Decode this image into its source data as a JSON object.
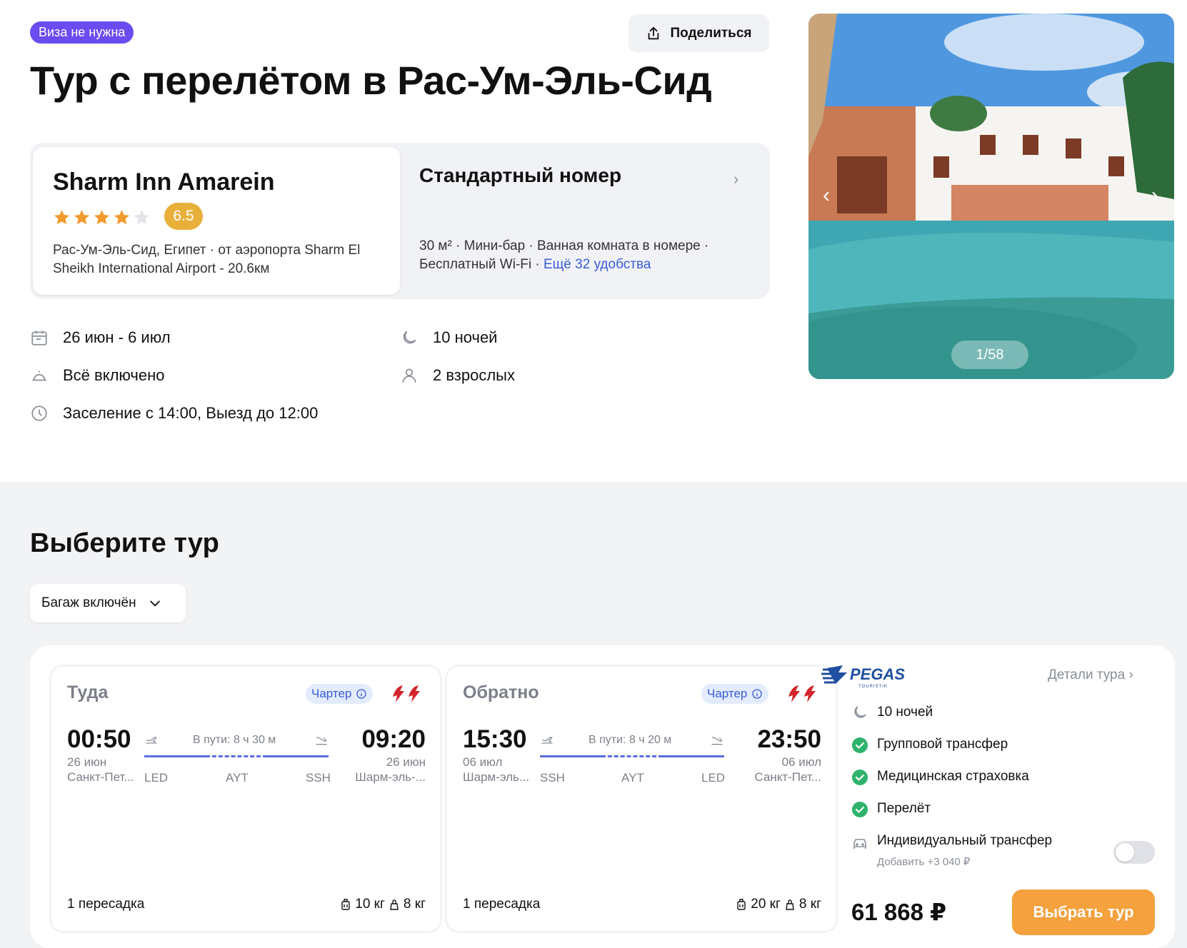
{
  "badge": "Виза не нужна",
  "share_label": "Поделиться",
  "title": "Тур с перелётом в Рас-Ум-Эль-Сид",
  "hotel": {
    "name": "Sharm Inn Amarein",
    "stars": 4,
    "max_stars": 5,
    "rating": "6.5",
    "location": "Рас-Ум-Эль-Сид, Египет · от аэропорта Sharm El Sheikh International Airport - 20.6км"
  },
  "room": {
    "title": "Стандартный номер",
    "features": "30 м² · Мини-бар · Ванная комната в номере · Бесплатный Wi-Fi · ",
    "more_link": "Ещё 32 удобства"
  },
  "facts": {
    "dates": "26 июн - 6 июл",
    "nights": "10 ночей",
    "meal": "Всё включено",
    "guests": "2 взрослых",
    "checkin": "Заселение с 14:00, Выезд до 12:00"
  },
  "photo": {
    "counter": "1/58"
  },
  "section_title": "Выберите тур",
  "filter_label": "Багаж включён",
  "segments": [
    {
      "direction": "Туда",
      "charter": "Чартер",
      "dep_time": "00:50",
      "dep_date": "26 июн",
      "dep_city": "Санкт-Пет...",
      "arr_time": "09:20",
      "arr_date": "26 июн",
      "arr_city": "Шарм-эль-...",
      "duration": "В пути: 8 ч 30 м",
      "airports": [
        "LED",
        "AYT",
        "SSH"
      ],
      "transfers": "1 пересадка",
      "baggage": "10 кг",
      "hand": "8 кг"
    },
    {
      "direction": "Обратно",
      "charter": "Чартер",
      "dep_time": "15:30",
      "dep_date": "06 июл",
      "dep_city": "Шарм-эль...",
      "arr_time": "23:50",
      "arr_date": "06 июл",
      "arr_city": "Санкт-Пет...",
      "duration": "В пути: 8 ч 20 м",
      "airports": [
        "SSH",
        "AYT",
        "LED"
      ],
      "transfers": "1 пересадка",
      "baggage": "20 кг",
      "hand": "8 кг"
    }
  ],
  "operator": {
    "logo_text": "PEGAS",
    "logo_sub": "TOURISTIK",
    "details_link": "Детали тура",
    "nights": "10 ночей",
    "included": [
      "Групповой трансфер",
      "Медицинская страховка",
      "Перелёт"
    ],
    "addon": {
      "label": "Индивидуальный трансфер",
      "sub": "Добавить +3 040 ₽",
      "enabled": false
    },
    "price": "61 868 ₽",
    "select_label": "Выбрать тур"
  },
  "colors": {
    "accent_purple": "#6a4cf0",
    "rating": "#e8b03a",
    "star": "#f29a2e",
    "link": "#3a5bd6",
    "check": "#2fb36b",
    "cta": "#f4a13e"
  }
}
